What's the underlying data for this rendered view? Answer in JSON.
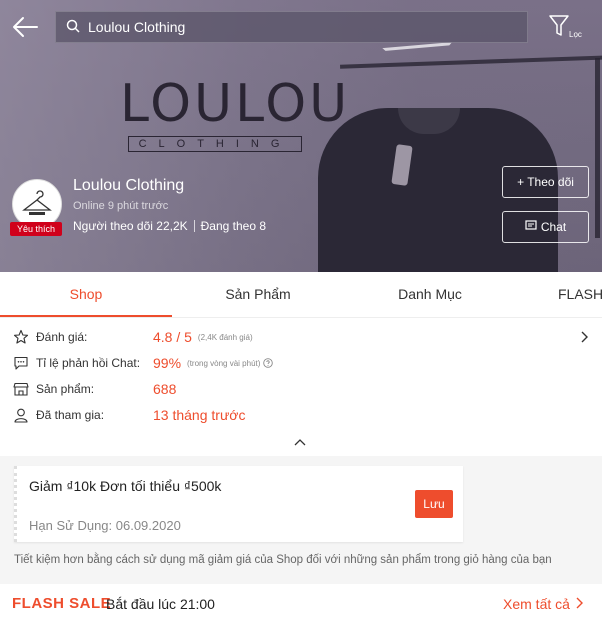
{
  "header": {
    "search_text": "Loulou Clothing",
    "filter_label": "Lọc",
    "banner_logo_word": "LOULOU",
    "banner_logo_sub": "CLOTHING"
  },
  "shop": {
    "name": "Loulou Clothing",
    "online_status": "Online 9 phút trước",
    "followers": "Người theo dõi 22,2K",
    "following": "Đang theo 8",
    "badge": "Yêu thích",
    "follow_button": "+ Theo dõi",
    "chat_button": "Chat"
  },
  "tabs": [
    {
      "label": "Shop",
      "active": true
    },
    {
      "label": "Sản Phẩm",
      "active": false
    },
    {
      "label": "Danh Mục",
      "active": false
    },
    {
      "label": "FLASH",
      "active": false
    }
  ],
  "info": {
    "rating": {
      "label": "Đánh giá:",
      "value": "4.8 / 5",
      "note": "(2,4K đánh giá)"
    },
    "chat_response": {
      "label": "Tỉ lệ phản hồi Chat:",
      "value": "99%",
      "note": "(trong vòng vài phút)"
    },
    "products": {
      "label": "Sản phẩm:",
      "value": "688"
    },
    "joined": {
      "label": "Đã tham gia:",
      "value": "13 tháng trước"
    }
  },
  "voucher": {
    "title": "Giảm ₫10k Đơn tối thiểu ₫500k",
    "expiry": "Hạn Sử Dụng: 06.09.2020",
    "save_label": "Lưu",
    "hint": "Tiết kiệm hơn bằng cách sử dụng mã giảm giá của Shop đối với những sản phẩm trong giỏ hàng của bạn"
  },
  "flash_sale": {
    "logo": "FLASH SALE",
    "start": "Bắt đầu lúc 21:00",
    "see_all": "Xem tất cả"
  },
  "colors": {
    "accent": "#ee4d2d",
    "badge": "#d0011b"
  }
}
